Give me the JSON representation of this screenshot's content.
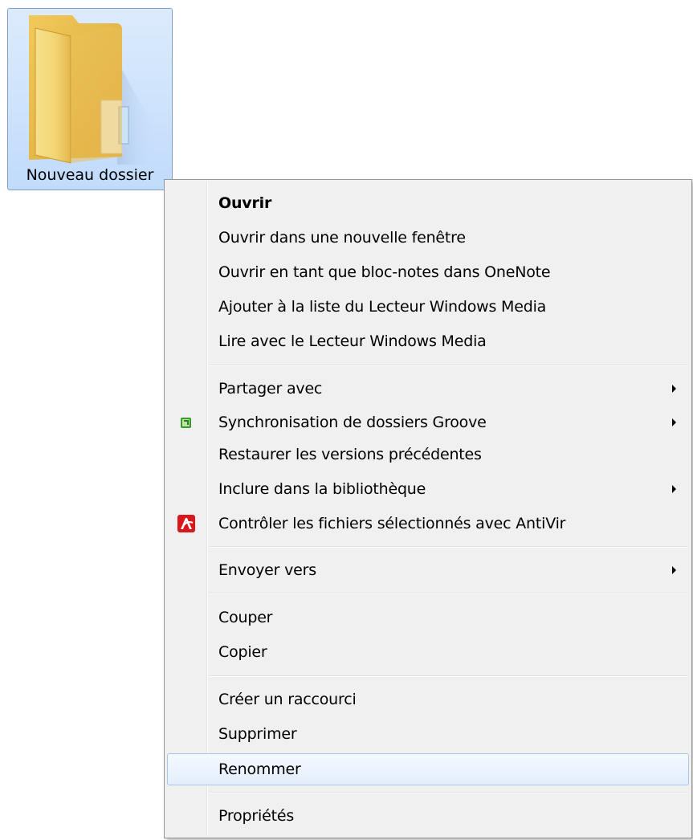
{
  "folder": {
    "label": "Nouveau dossier",
    "icon": "folder-icon"
  },
  "menu": {
    "items": [
      {
        "label": "Ouvrir",
        "bold": true
      },
      {
        "label": "Ouvrir dans une nouvelle fenêtre"
      },
      {
        "label": "Ouvrir en tant que bloc-notes dans OneNote"
      },
      {
        "label": "Ajouter à la liste du Lecteur Windows Media"
      },
      {
        "label": "Lire avec le Lecteur Windows Media"
      },
      {
        "label": "Partager avec",
        "submenu": true
      },
      {
        "label": "Synchronisation de dossiers Groove",
        "submenu": true,
        "icon": "groove-sync-icon"
      },
      {
        "label": "Restaurer les versions précédentes"
      },
      {
        "label": "Inclure dans la bibliothèque",
        "submenu": true
      },
      {
        "label": "Contrôler les fichiers sélectionnés avec AntiVir",
        "icon": "antivir-icon"
      },
      {
        "label": "Envoyer vers",
        "submenu": true
      },
      {
        "label": "Couper"
      },
      {
        "label": "Copier"
      },
      {
        "label": "Créer un raccourci"
      },
      {
        "label": "Supprimer"
      },
      {
        "label": "Renommer",
        "hovered": true
      },
      {
        "label": "Propriétés"
      }
    ]
  },
  "colors": {
    "selection_border": "#7da2ce",
    "menu_background": "#f0f0f0",
    "hover_border": "#a8c6ee",
    "antivir_red": "#d8171c",
    "groove_green": "#3b9a2c"
  }
}
